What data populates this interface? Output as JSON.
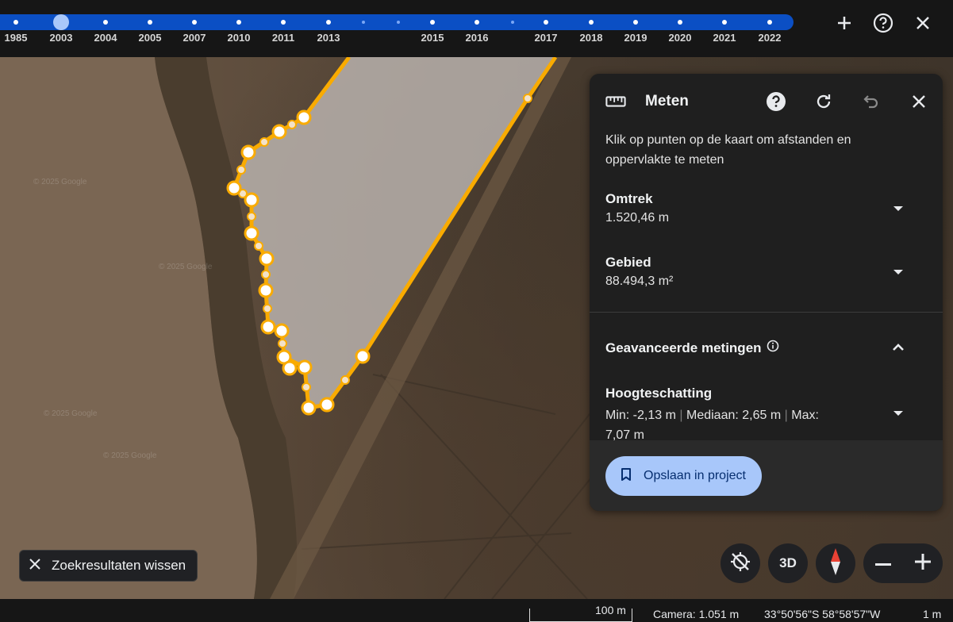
{
  "timeline": {
    "years": [
      "1985",
      "2003",
      "2004",
      "2005",
      "2007",
      "2010",
      "2011",
      "2013",
      "2015",
      "2016",
      "2017",
      "2018",
      "2019",
      "2020",
      "2021",
      "2022"
    ],
    "selected_year": "2003"
  },
  "top_controls": {
    "collapse_icon": "collapse-arrows-icon",
    "help_icon": "help-circle-icon",
    "close_icon": "close-icon"
  },
  "measure": {
    "title": "Meten",
    "description": "Klik op punten op de kaart om afstanden en oppervlakte te meten",
    "perimeter_label": "Omtrek",
    "perimeter_value": "1.520,46 m",
    "area_label": "Gebied",
    "area_value": "88.494,3 m²",
    "advanced_label": "Geavanceerde metingen",
    "height_label": "Hoogteschatting",
    "height_min": "Min: -2,13 m",
    "height_median": "Mediaan: 2,65 m",
    "height_max": "Max:",
    "height_max_value": "7,07 m",
    "save_label": "Opslaan in project"
  },
  "map": {
    "watermark": "© 2025 Google",
    "clear_search_label": "Zoekresultaten wissen",
    "btn_3d_label": "3D",
    "measure_line_color": "#f9ab00"
  },
  "statusbar": {
    "scale": "100 m",
    "camera": "Camera: 1.051 m",
    "coordinates": "33°50'56\"S 58°58'57\"W",
    "elevation": "1 m"
  }
}
